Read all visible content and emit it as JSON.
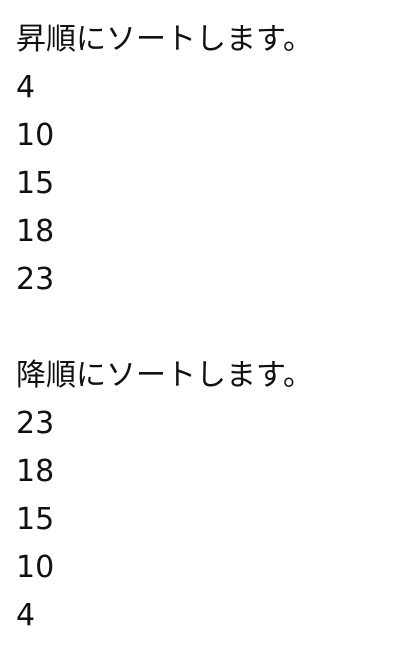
{
  "output": {
    "ascending": {
      "heading": "昇順にソートします。",
      "values": [
        "4",
        "10",
        "15",
        "18",
        "23"
      ]
    },
    "descending": {
      "heading": "降順にソートします。",
      "values": [
        "23",
        "18",
        "15",
        "10",
        "4"
      ]
    }
  }
}
